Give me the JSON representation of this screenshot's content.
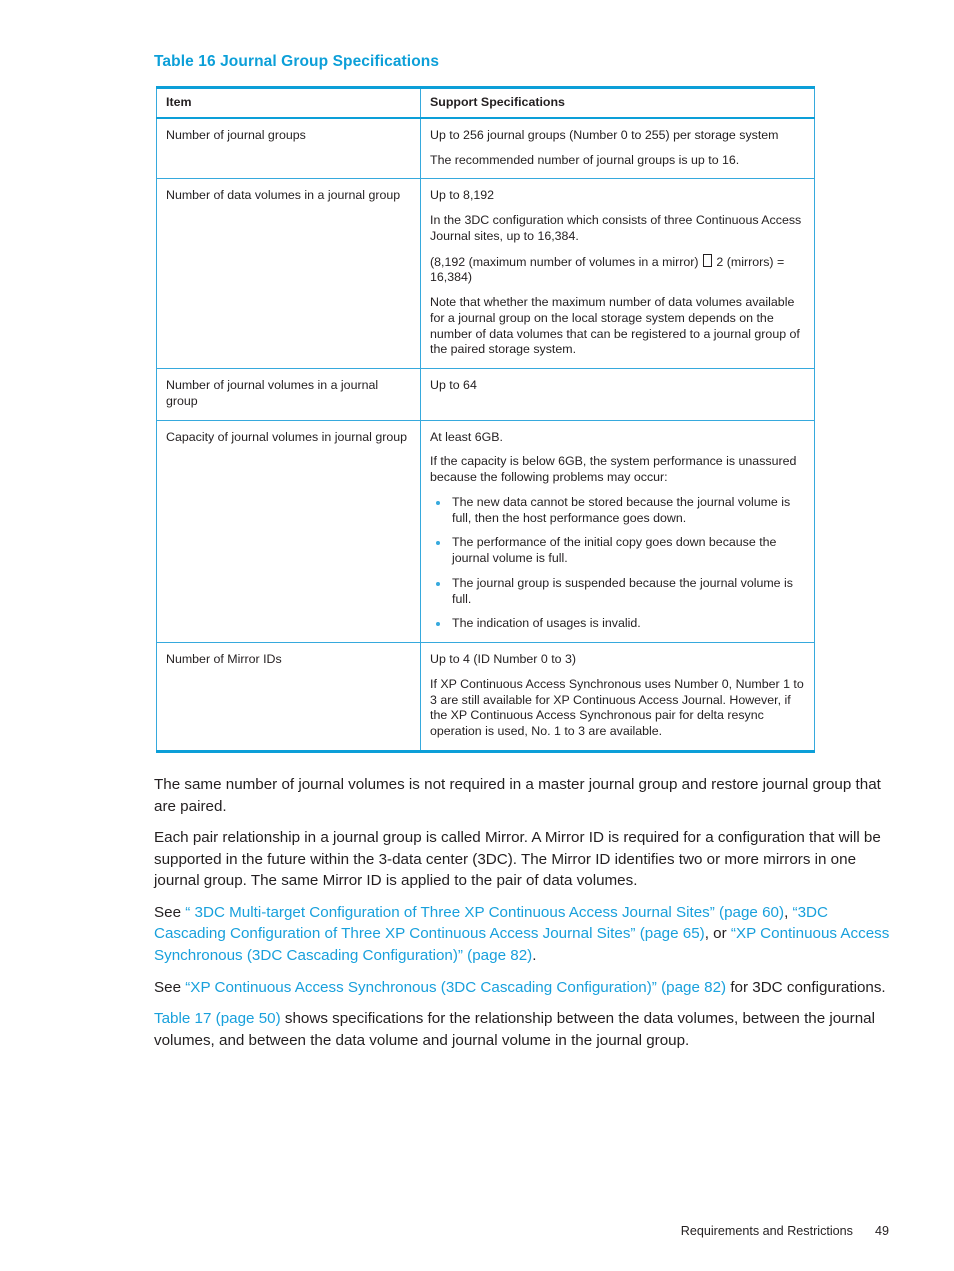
{
  "table": {
    "caption": "Table 16 Journal Group Specifications",
    "columns": [
      "Item",
      "Support Specifications"
    ],
    "rows": [
      {
        "item": "Number of journal groups",
        "paragraphs": [
          "Up to 256 journal groups (Number 0 to 255) per storage system",
          "The recommended number of journal groups is up to 16."
        ],
        "bullets": []
      },
      {
        "item": "Number of data volumes in a journal group",
        "paragraphs": [
          "Up to 8,192",
          "In the 3DC configuration which consists of three Continuous Access Journal sites, up to 16,384.",
          "(8,192 (maximum number of volumes in a mirror) □ 2 (mirrors) = 16,384)",
          "Note that whether the maximum number of data volumes available for a journal group on the local storage system depends on the number of data volumes that can be registered to a journal group of the paired storage system."
        ],
        "bullets": []
      },
      {
        "item": "Number of journal volumes in a journal group",
        "paragraphs": [
          "Up to 64"
        ],
        "bullets": []
      },
      {
        "item": "Capacity of journal volumes in journal group",
        "paragraphs": [
          "At least 6GB.",
          "If the capacity is below 6GB, the system performance is unassured because the following problems may occur:"
        ],
        "bullets": [
          "The new data cannot be stored because the journal volume is full, then the host performance goes down.",
          "The performance of the initial copy goes down because the journal volume is full.",
          "The journal group is suspended because the journal volume is full.",
          "The indication of usages is invalid."
        ]
      },
      {
        "item": "Number of Mirror IDs",
        "paragraphs": [
          "Up to 4 (ID Number 0 to 3)",
          "If XP Continuous Access Synchronous uses Number 0, Number 1 to 3 are still available for XP Continuous Access Journal. However, if the XP Continuous Access Synchronous pair for delta resync operation is used, No. 1 to 3 are available."
        ],
        "bullets": []
      }
    ]
  },
  "body": {
    "p1": "The same number of journal volumes is not required in a master journal group and restore journal group that are paired.",
    "p2": "Each pair relationship in a journal group is called Mirror. A Mirror ID is required for a configuration that will be supported in the future within the 3-data center (3DC). The Mirror ID identifies two or more mirrors in one journal group. The same Mirror ID is applied to the pair of data volumes.",
    "p3": {
      "lead": "See ",
      "link1": "“ 3DC Multi-target Configuration of Three XP Continuous Access Journal Sites” (page 60)",
      "sep1": ", ",
      "link2": "“3DC Cascading Configuration of Three XP Continuous Access Journal Sites” (page 65)",
      "sep2": ", or ",
      "link3": "“XP Continuous Access Synchronous (3DC Cascading Configuration)” (page 82)",
      "tail": "."
    },
    "p4": {
      "lead": "See ",
      "link": "“XP Continuous Access Synchronous (3DC Cascading Configuration)” (page 82)",
      "tail": " for 3DC configurations."
    },
    "p5": {
      "link": "Table 17 (page 50)",
      "tail": " shows specifications for the relationship between the data volumes, between the journal volumes, and between the data volume and journal volume in the journal group."
    }
  },
  "footer": {
    "section": "Requirements and Restrictions",
    "page_number": "49"
  },
  "colors": {
    "accent_blue": "#0c9fd8",
    "rule_blue": "#36a9dd",
    "link_blue": "#18a0dc",
    "text": "#231f20"
  }
}
